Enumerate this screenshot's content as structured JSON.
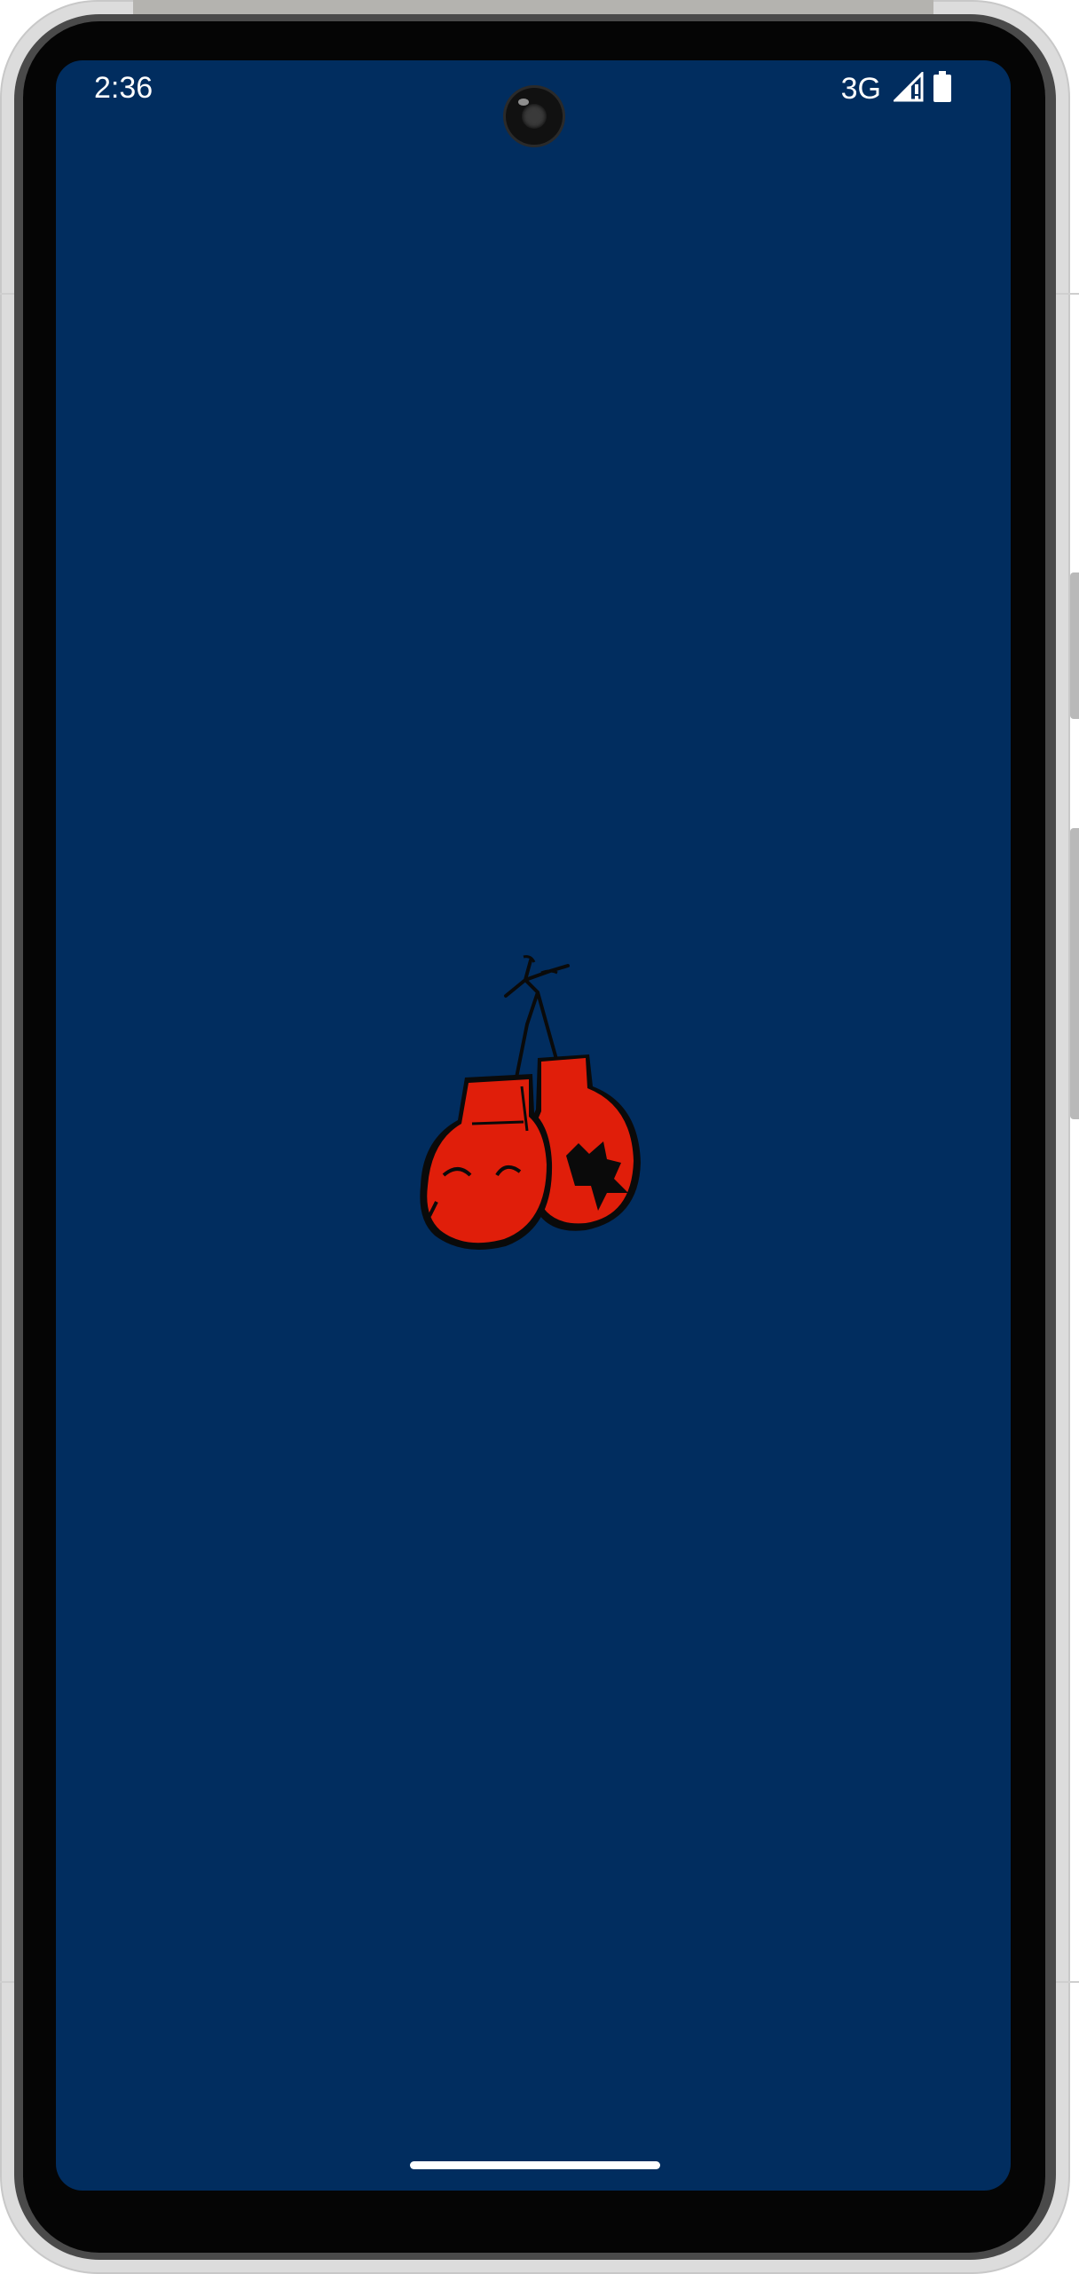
{
  "status_bar": {
    "time": "2:36",
    "network": "3G",
    "signal_icon": "signal-icon",
    "battery_icon": "battery-icon"
  },
  "splash": {
    "background_color": "#012d5f",
    "logo_icon": "boxing-gloves-icon",
    "logo_colors": {
      "glove": "#e01e0a",
      "outline": "#0a0a0a"
    }
  },
  "navigation": {
    "home_indicator": "home-indicator"
  }
}
